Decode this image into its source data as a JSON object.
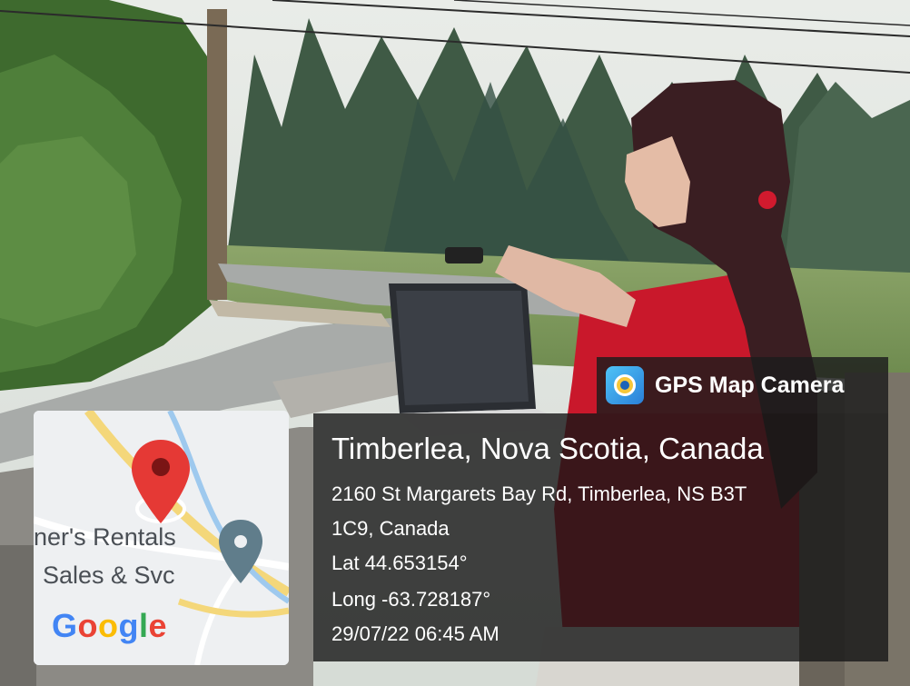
{
  "overlay": {
    "app_name": "GPS Map Camera",
    "icon": "gps-map-camera-icon",
    "location_title": "Timberlea, Nova Scotia, Canada",
    "address_line_1": "2160 St Margarets Bay Rd, Timberlea, NS B3T",
    "address_line_2": "1C9, Canada",
    "latitude": "Lat 44.653154°",
    "longitude": "Long -63.728187°",
    "datetime": "29/07/22 06:45 AM"
  },
  "map": {
    "label_1": "ner's Rentals",
    "label_2": "Sales & Svc",
    "pin_icon": "map-pin-icon",
    "place_marker_icon": "place-marker-icon",
    "logo_text": "Google",
    "logo_letters": [
      "G",
      "o",
      "o",
      "g",
      "l",
      "e"
    ],
    "logo_colors": [
      "#4285F4",
      "#EA4335",
      "#FBBC05",
      "#4285F4",
      "#34A853",
      "#EA4335"
    ],
    "pin_color": "#E53935",
    "marker_color": "#607D8B"
  }
}
